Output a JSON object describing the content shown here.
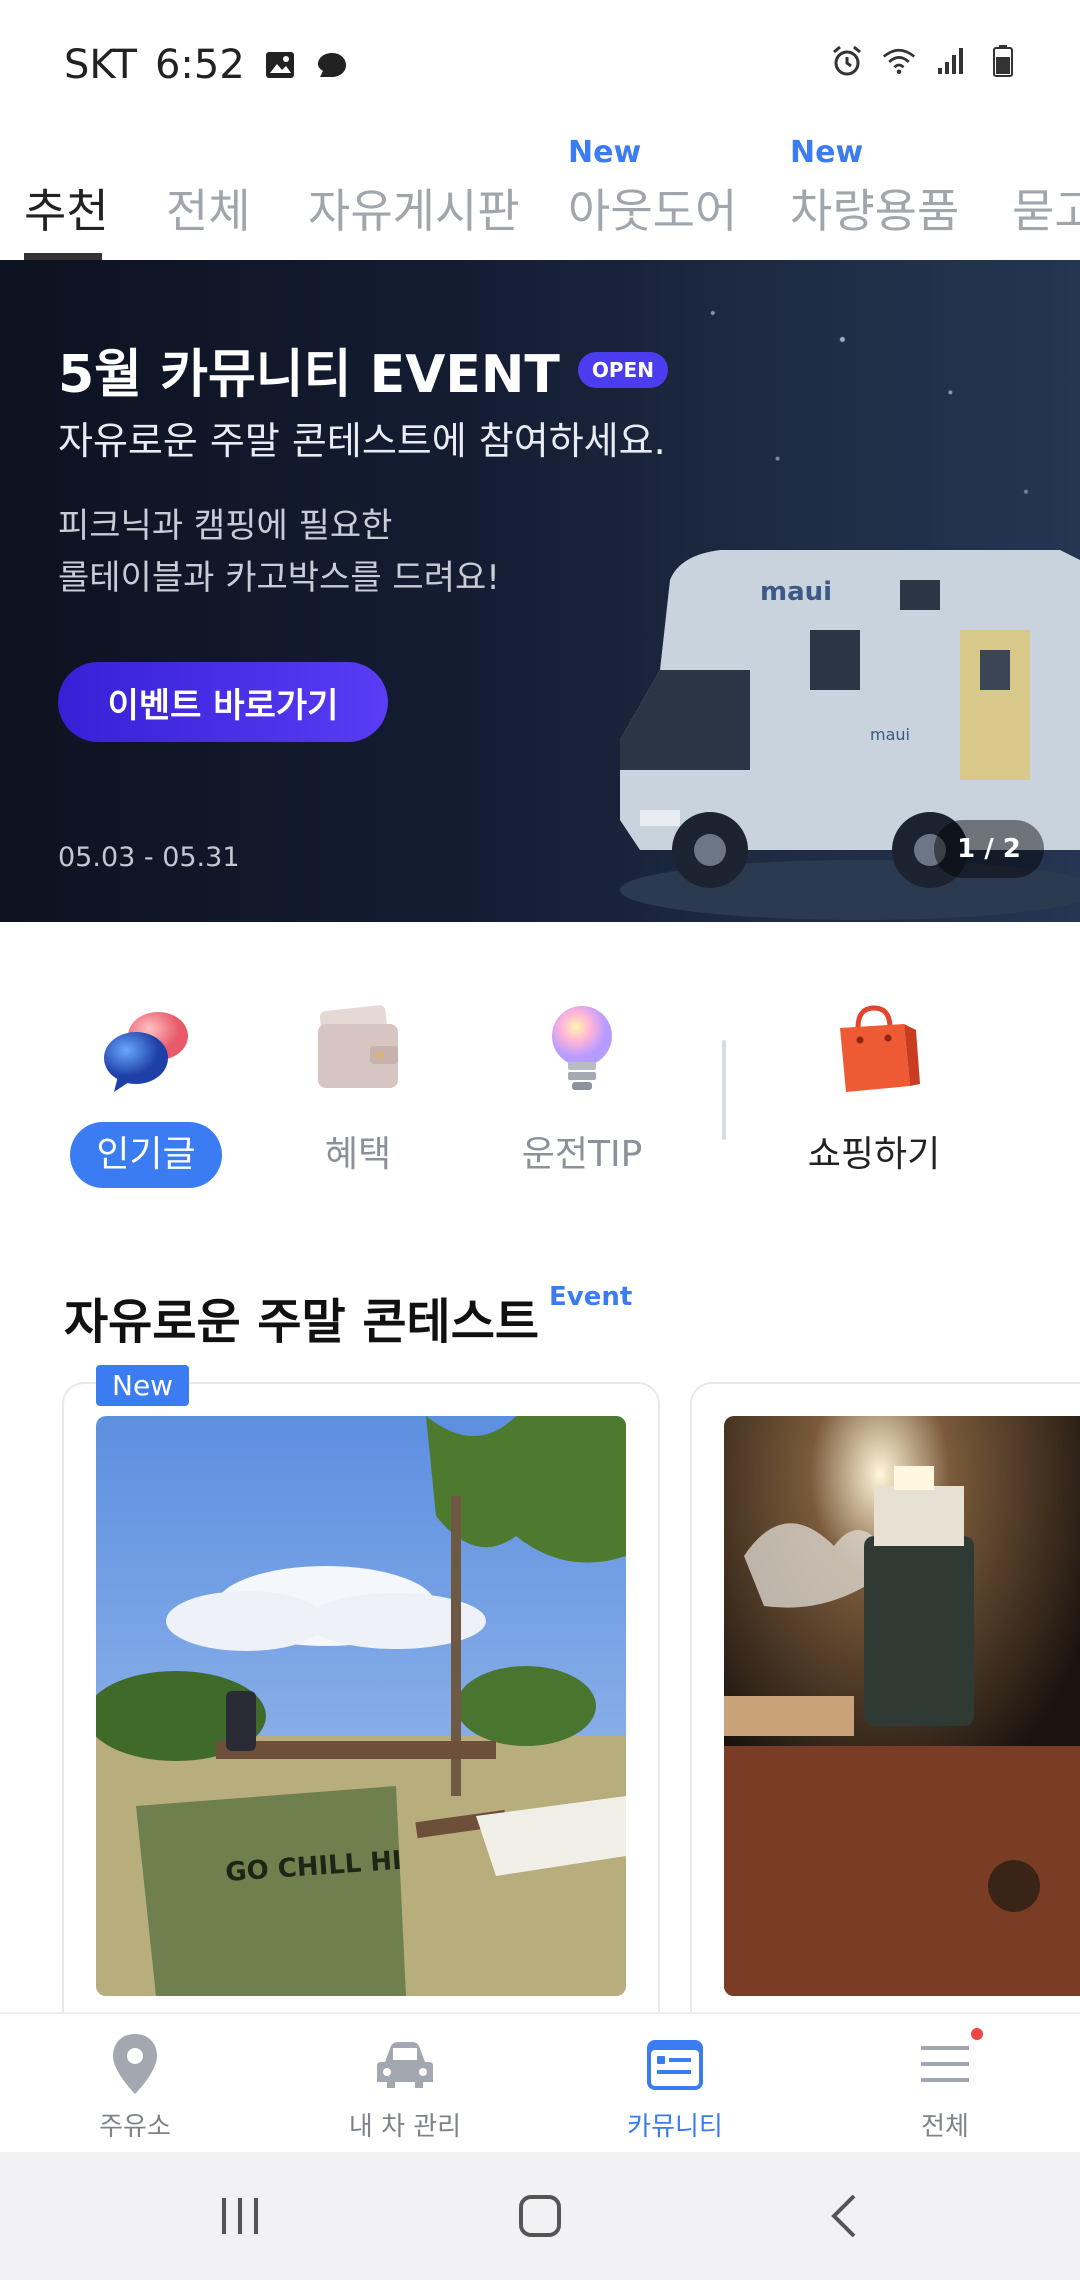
{
  "status_bar": {
    "carrier": "SKT",
    "time": "6:52"
  },
  "tabs": [
    {
      "label": "추천",
      "new": ""
    },
    {
      "label": "전체",
      "new": ""
    },
    {
      "label": "자유게시판",
      "new": ""
    },
    {
      "label": "아웃도어",
      "new": "New"
    },
    {
      "label": "차량용품",
      "new": "New"
    },
    {
      "label": "묻고",
      "new": ""
    }
  ],
  "banner": {
    "title": "5월 카뮤니티 EVENT",
    "badge": "OPEN",
    "subtitle": "자유로운 주말 콘테스트에 참여하세요.",
    "desc_line1": "피크닉과 캠핑에 필요한",
    "desc_line2": "롤테이블과 카고박스를 드려요!",
    "cta": "이벤트 바로가기",
    "date": "05.03 - 05.31",
    "pager": "1 / 2",
    "vehicle_text": "maui"
  },
  "quick_menu": [
    {
      "label": "인기글",
      "icon": "speech-bubbles-icon",
      "selected": true
    },
    {
      "label": "혜택",
      "icon": "wallet-icon",
      "selected": false
    },
    {
      "label": "운전TIP",
      "icon": "lightbulb-icon",
      "selected": false
    },
    {
      "label": "쇼핑하기",
      "icon": "shopping-bag-icon",
      "selected": false
    }
  ],
  "section": {
    "title": "자유로운 주말 콘테스트",
    "tag": "Event",
    "card_new_tag": "New",
    "card1_chair_text": "GO CHILL HI"
  },
  "bottom_nav": [
    {
      "label": "주유소",
      "icon": "location-pin-icon"
    },
    {
      "label": "내 차 관리",
      "icon": "car-icon"
    },
    {
      "label": "카뮤니티",
      "icon": "community-card-icon",
      "active": true
    },
    {
      "label": "전체",
      "icon": "menu-icon"
    }
  ],
  "colors": {
    "accent": "#3b7cf2",
    "banner_cta": "#4c3cf0",
    "notification_dot": "#f04545"
  }
}
